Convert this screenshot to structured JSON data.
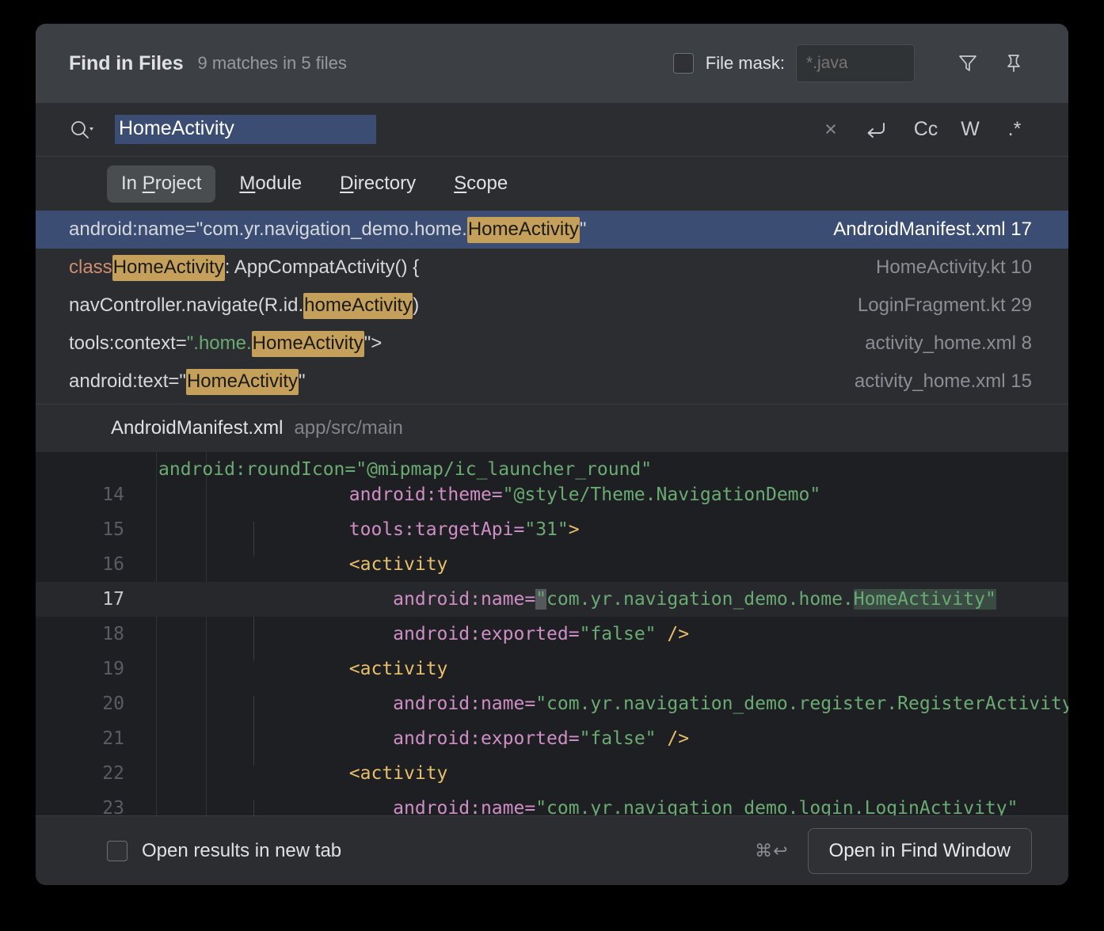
{
  "header": {
    "title": "Find in Files",
    "matches": "9 matches in 5 files",
    "file_mask_label": "File mask:",
    "file_mask_placeholder": "*.java",
    "file_mask_value": "",
    "file_mask_checked": false,
    "filter_icon": "filter-icon",
    "pin_icon": "pin-icon"
  },
  "search": {
    "query": "HomeActivity",
    "placeholder": "",
    "selected": true,
    "icons": {
      "search": "search-icon",
      "clear": "×",
      "wrap": "↩",
      "match_case": "Cc",
      "whole_words": "W",
      "regex": ".*"
    }
  },
  "tabs": [
    {
      "label": "In Project",
      "mnemonic": "P",
      "active": true
    },
    {
      "label": "Module",
      "mnemonic": "M",
      "active": false
    },
    {
      "label": "Directory",
      "mnemonic": "D",
      "active": false
    },
    {
      "label": "Scope",
      "mnemonic": "S",
      "active": false
    }
  ],
  "results": [
    {
      "selected": true,
      "parts": [
        {
          "t": "android:name=\"com.yr.navigation_demo.home.",
          "c": "plain"
        },
        {
          "t": "HomeActivity",
          "c": "match"
        },
        {
          "t": "\"",
          "c": "plain"
        }
      ],
      "file": "AndroidManifest.xml 17"
    },
    {
      "selected": false,
      "parts": [
        {
          "t": "class ",
          "c": "kw"
        },
        {
          "t": "HomeActivity",
          "c": "match"
        },
        {
          "t": " : AppCompatActivity() {",
          "c": "plain"
        }
      ],
      "file": "HomeActivity.kt 10"
    },
    {
      "selected": false,
      "parts": [
        {
          "t": "navController.navigate(R.id.",
          "c": "plain"
        },
        {
          "t": "homeActivity",
          "c": "match"
        },
        {
          "t": ")",
          "c": "plain"
        }
      ],
      "file": "LoginFragment.kt 29"
    },
    {
      "selected": false,
      "parts": [
        {
          "t": "tools:context=",
          "c": "plain"
        },
        {
          "t": "\".home.",
          "c": "str"
        },
        {
          "t": "HomeActivity",
          "c": "match"
        },
        {
          "t": "\">",
          "c": "plain"
        }
      ],
      "file": "activity_home.xml 8"
    },
    {
      "selected": false,
      "parts": [
        {
          "t": "android:text=\"",
          "c": "plain"
        },
        {
          "t": "HomeActivity",
          "c": "match"
        },
        {
          "t": "\"",
          "c": "plain"
        }
      ],
      "file": "activity_home.xml 15"
    }
  ],
  "preview": {
    "file_name": "AndroidManifest.xml",
    "file_path": "app/src/main",
    "lines": [
      {
        "num": "14",
        "current": false,
        "tokens": [
          {
            "t": "        android:theme=",
            "c": "attr"
          },
          {
            "t": "\"@style/Theme.NavigationDemo\"",
            "c": "val"
          }
        ]
      },
      {
        "num": "15",
        "current": false,
        "tokens": [
          {
            "t": "        tools:targetApi=",
            "c": "attr"
          },
          {
            "t": "\"31\"",
            "c": "val"
          },
          {
            "t": ">",
            "c": "tag"
          }
        ]
      },
      {
        "num": "16",
        "current": false,
        "tokens": [
          {
            "t": "        <activity",
            "c": "tag"
          }
        ]
      },
      {
        "num": "17",
        "current": true,
        "tokens": [
          {
            "t": "            android:name=",
            "c": "attr"
          },
          {
            "t": "\"",
            "c": "caret"
          },
          {
            "t": "com.yr.navigation_demo.home.",
            "c": "val"
          },
          {
            "t": "HomeActivity\"",
            "c": "valmatch"
          }
        ]
      },
      {
        "num": "18",
        "current": false,
        "tokens": [
          {
            "t": "            android:exported=",
            "c": "attr"
          },
          {
            "t": "\"false\" ",
            "c": "val"
          },
          {
            "t": "/>",
            "c": "tag"
          }
        ]
      },
      {
        "num": "19",
        "current": false,
        "tokens": [
          {
            "t": "        <activity",
            "c": "tag"
          }
        ]
      },
      {
        "num": "20",
        "current": false,
        "tokens": [
          {
            "t": "            android:name=",
            "c": "attr"
          },
          {
            "t": "\"com.yr.navigation_demo.register.RegisterActivity\"",
            "c": "val"
          }
        ]
      },
      {
        "num": "21",
        "current": false,
        "tokens": [
          {
            "t": "            android:exported=",
            "c": "attr"
          },
          {
            "t": "\"false\" ",
            "c": "val"
          },
          {
            "t": "/>",
            "c": "tag"
          }
        ]
      },
      {
        "num": "22",
        "current": false,
        "tokens": [
          {
            "t": "        <activity",
            "c": "tag"
          }
        ]
      },
      {
        "num": "23",
        "current": false,
        "tokens": [
          {
            "t": "            android:name=",
            "c": "attr"
          },
          {
            "t": "\"com.yr.navigation_demo.login.LoginActivity\"",
            "c": "val"
          }
        ]
      }
    ]
  },
  "footer": {
    "checkbox_label": "Open results in new tab",
    "checkbox_checked": false,
    "shortcut": "⌘↩",
    "button_label": "Open in Find Window"
  },
  "colors": {
    "dialog_bg": "#2b2d30",
    "header_bg": "#3c3f43",
    "code_bg": "#1e1f22",
    "selection_blue": "#3b4d73",
    "match_highlight": "#c5a05a",
    "string_green": "#6aab73",
    "attr_pink": "#cf8ec5",
    "tag_yellow": "#e8bf6a"
  }
}
